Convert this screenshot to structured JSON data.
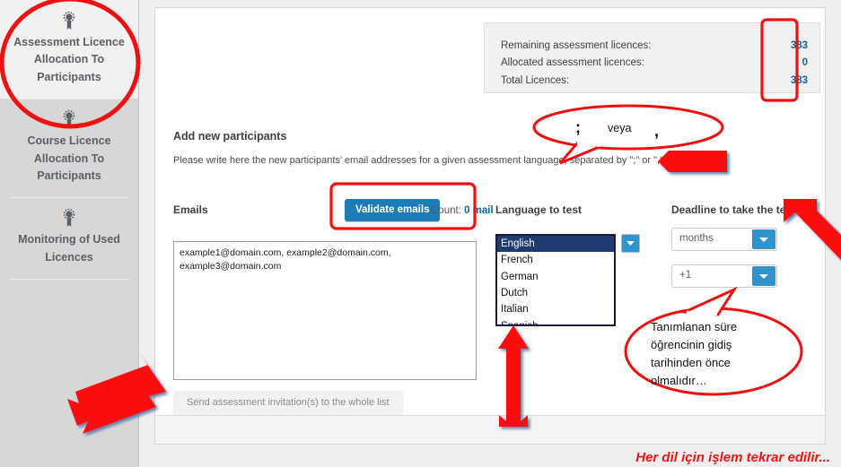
{
  "sidebar": {
    "items": [
      {
        "label": "Assessment Licence Allocation To Participants",
        "icon": "award-ribbon-icon",
        "active": true
      },
      {
        "label": "Course Licence Allocation To Participants",
        "icon": "award-ribbon-icon",
        "active": false
      },
      {
        "label": "Monitoring of Used Licences",
        "icon": "award-ribbon-icon",
        "active": false
      }
    ]
  },
  "licence_summary": {
    "rows": [
      {
        "label": "Remaining assessment licences:",
        "value": "383"
      },
      {
        "label": "Allocated assessment licences:",
        "value": "0"
      },
      {
        "label": "Total Licences:",
        "value": "383"
      }
    ]
  },
  "form": {
    "section_title": "Add new participants",
    "instruction": "Please write here the new participants' email addresses for a given assessment language, separated by \";\" or \",\".",
    "emails_label": "Emails",
    "validate_button": "Validate emails",
    "count_prefix": "Count: ",
    "count_value": "0 mail",
    "emails_value": "example1@domain.com, example2@domain.com,\nexample3@domain.com",
    "emails_placeholder": "example1@domain.com, example2@domain.com",
    "send_button": "Send assessment invitation(s) to the whole list"
  },
  "language": {
    "label": "Language to test",
    "options": [
      "English",
      "French",
      "German",
      "Dutch",
      "Italian",
      "Spanish"
    ],
    "selected": "English",
    "dropdown_icon": "chevron-down-icon"
  },
  "deadline": {
    "label": "Deadline to take the test",
    "unit_select": {
      "value": "months",
      "icon": "chevron-down-icon"
    },
    "amount_select": {
      "value": "+1",
      "icon": "chevron-down-icon"
    }
  },
  "annotations": {
    "separator_bubble": {
      "left": ";",
      "middle": "veya",
      "right": ","
    },
    "deadline_bubble": "Tanımlanan süre öğrencinin gidiş tarihinden önce olmalıdır…",
    "footer_note": "Her dil için işlem tekrar edilir...",
    "accent_color": "#ee1111",
    "arrows": [
      {
        "name": "arrow-to-instruction",
        "direction": "left"
      },
      {
        "name": "arrow-to-deadline-label",
        "direction": "up-left"
      },
      {
        "name": "arrow-to-language-list",
        "direction": "up"
      },
      {
        "name": "arrow-to-send-button",
        "direction": "up-right"
      }
    ]
  }
}
